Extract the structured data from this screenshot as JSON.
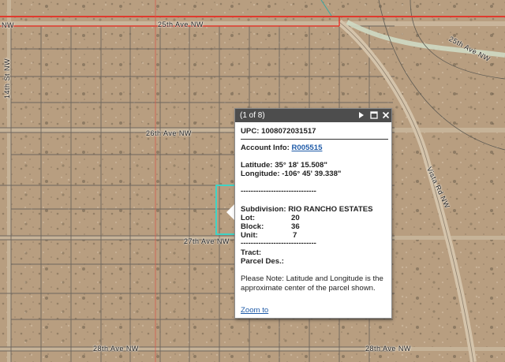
{
  "map": {
    "streets": [
      {
        "label": "25th Ave NW",
        "key": "s1"
      },
      {
        "label": "NW",
        "key": "s2"
      },
      {
        "label": "25th Ave NW",
        "key": "s3"
      },
      {
        "label": "14th St NW",
        "key": "s4"
      },
      {
        "label": "26th Ave NW",
        "key": "s5"
      },
      {
        "label": "27th Ave NW",
        "key": "s6"
      },
      {
        "label": "28th Ave NW",
        "key": "s7"
      },
      {
        "label": "28th Ave NW",
        "key": "s8"
      },
      {
        "label": "Vista Rd NW",
        "key": "s9"
      }
    ]
  },
  "popup": {
    "count": "(1 of 8)",
    "upc_label": "UPC:",
    "upc_value": "1008072031517",
    "account_label": "Account Info:",
    "account_value": "R005515",
    "lat_label": "Latitude:",
    "lat_value": "35° 18' 15.508\"",
    "lon_label": "Longitude:",
    "lon_value": "-106° 45' 39.338\"",
    "divider1": "------------------------------",
    "subdivision_label": "Subdivision:",
    "subdivision_value": "RIO RANCHO ESTATES",
    "lot_label": "Lot:",
    "lot_value": "20",
    "block_label": "Block:",
    "block_value": "36",
    "unit_label": "Unit:",
    "unit_value": "7",
    "divider2": "------------------------------",
    "tract_label": "Tract:",
    "parcel_label": "Parcel Des.:",
    "note": "Please Note: Latitude and Longitude is the approximate center of the parcel shown.",
    "zoom_label": "Zoom to"
  },
  "colors": {
    "ground": "#b89e80",
    "parcel_line": "#6e665e",
    "road_highlight": "#e03a2e",
    "selection": "#3fd3c6",
    "popup_header": "#4d4d4d"
  }
}
